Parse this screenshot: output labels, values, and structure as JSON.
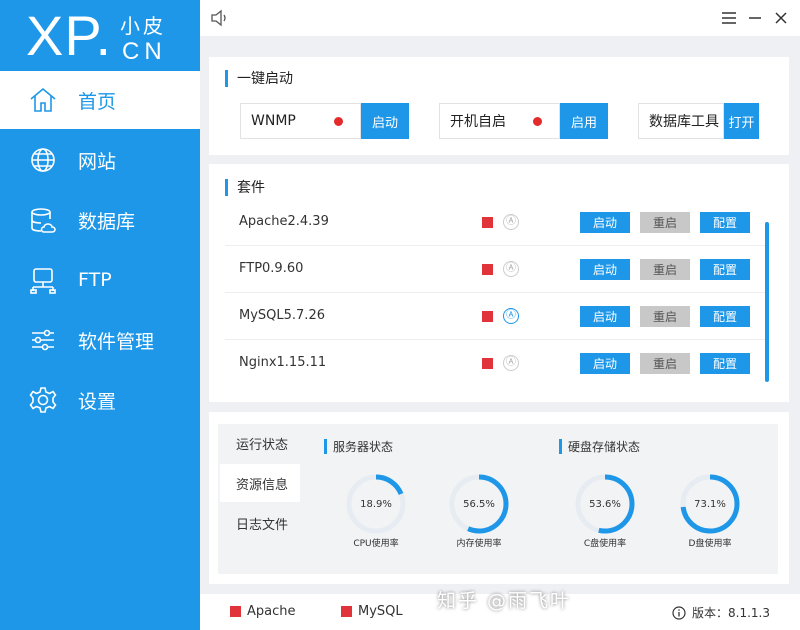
{
  "brand": {
    "logo_main": "XP.",
    "logo_cn_top": "小皮",
    "logo_cn_bottom": "CN"
  },
  "sidebar": {
    "items": [
      {
        "label": "首页",
        "icon": "home-icon",
        "active": true
      },
      {
        "label": "网站",
        "icon": "globe-icon",
        "active": false
      },
      {
        "label": "数据库",
        "icon": "database-icon",
        "active": false
      },
      {
        "label": "FTP",
        "icon": "ftp-icon",
        "active": false
      },
      {
        "label": "软件管理",
        "icon": "sliders-icon",
        "active": false
      },
      {
        "label": "设置",
        "icon": "gear-icon",
        "active": false
      }
    ]
  },
  "quick_start": {
    "title": "一键启动",
    "items": [
      {
        "label": "WNMP",
        "status": "stopped",
        "button": "启动"
      },
      {
        "label": "开机自启",
        "status": "off",
        "button": "启用"
      },
      {
        "label": "数据库工具",
        "button": "打开"
      }
    ]
  },
  "suite": {
    "title": "套件",
    "rows": [
      {
        "name": "Apache2.4.39",
        "auto_icon": "Ⓐ",
        "auto": false,
        "start": "启动",
        "restart": "重启",
        "config": "配置"
      },
      {
        "name": "FTP0.9.60",
        "auto_icon": "Ⓐ",
        "auto": false,
        "start": "启动",
        "restart": "重启",
        "config": "配置"
      },
      {
        "name": "MySQL5.7.26",
        "auto_icon": "Ⓐ",
        "auto": true,
        "start": "启动",
        "restart": "重启",
        "config": "配置"
      },
      {
        "name": "Nginx1.15.11",
        "auto_icon": "Ⓐ",
        "auto": false,
        "start": "启动",
        "restart": "重启",
        "config": "配置"
      }
    ]
  },
  "status_panel": {
    "tabs": [
      {
        "label": "运行状态",
        "active": false
      },
      {
        "label": "资源信息",
        "active": true
      },
      {
        "label": "日志文件",
        "active": false
      }
    ],
    "server_title": "服务器状态",
    "disk_title": "硬盘存储状态",
    "gauges": [
      {
        "value": "18.9%",
        "fraction": 0.189,
        "label": "CPU使用率"
      },
      {
        "value": "56.5%",
        "fraction": 0.565,
        "label": "内存使用率"
      },
      {
        "value": "53.6%",
        "fraction": 0.536,
        "label": "C盘使用率"
      },
      {
        "value": "73.1%",
        "fraction": 0.731,
        "label": "D盘使用率"
      }
    ]
  },
  "footer": {
    "legend": [
      {
        "label": "Apache"
      },
      {
        "label": "MySQL"
      }
    ],
    "version_label": "版本：",
    "version": "8.1.1.3"
  },
  "watermark": "知乎 @雨飞叶",
  "colors": {
    "accent": "#1e97e8",
    "status_red": "#e0343a",
    "gauge_track": "#e6ecf2"
  }
}
